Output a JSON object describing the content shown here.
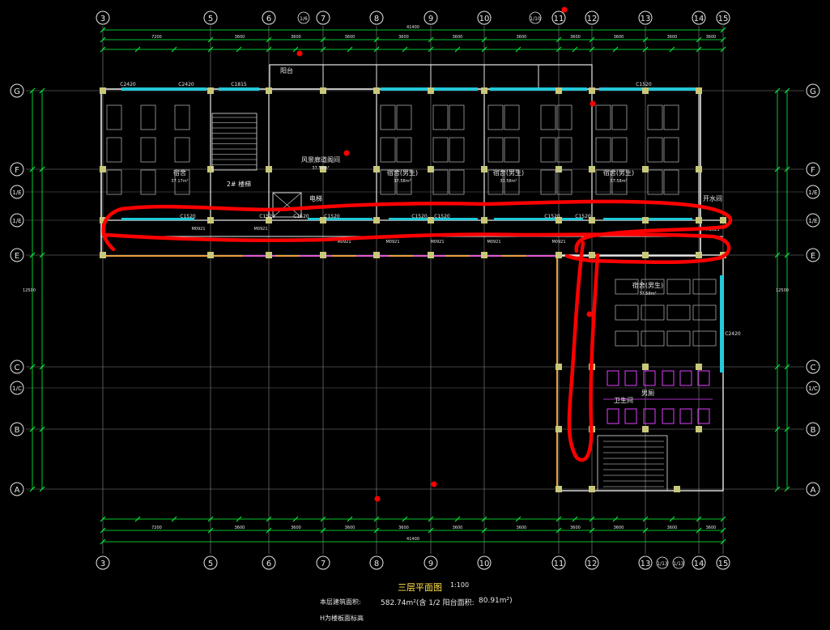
{
  "drawing": {
    "title": "三层平面图",
    "scale": "1:100",
    "area_label": "本层建筑面积:",
    "area_value": "582.74m²(含 1/2 阳台面积:",
    "balcony_area": "80.91m²)",
    "note": "H为楼板面标高"
  },
  "axes": {
    "column_labels": [
      "3",
      "5",
      "6",
      "7",
      "8",
      "9",
      "10",
      "11",
      "12",
      "13",
      "14",
      "15"
    ],
    "row_labels": [
      "G",
      "F",
      "E",
      "C",
      "B",
      "A"
    ],
    "row_half_labels": [
      "1/E",
      "1/E",
      "1/C"
    ]
  },
  "dims": {
    "top_total": "41400",
    "top": [
      "7200",
      "3600",
      "3600",
      "3600",
      "3600",
      "3600",
      "3600",
      "3600",
      "3600",
      "3600",
      "3600"
    ],
    "bottom_total": "41400",
    "bottom": [
      "7200",
      "3600",
      "3600",
      "3600",
      "3600",
      "3600",
      "3600",
      "3600",
      "3600",
      "3600",
      "3600"
    ],
    "left_total": "12500",
    "right_total": "12500"
  },
  "rooms": [
    {
      "key": "dorm1",
      "name": "宿舍",
      "area": "37.17m²"
    },
    {
      "key": "stair1",
      "name": "2# 楼梯"
    },
    {
      "key": "lounge",
      "name": "风景廊道阁间",
      "area": "37.58m²"
    },
    {
      "key": "elev",
      "name": "电梯"
    },
    {
      "key": "dorm2",
      "name": "宿舍(男生)",
      "area": "37.58m²"
    },
    {
      "key": "dorm3",
      "name": "宿舍(男生)",
      "area": "37.58m²"
    },
    {
      "key": "dorm4",
      "name": "宿舍(男生)",
      "area": "37.58m²"
    },
    {
      "key": "water",
      "name": "开水间"
    },
    {
      "key": "dorm5",
      "name": "宿舍(男生)",
      "area": "37.58m²"
    },
    {
      "key": "bath",
      "name": "卫生间"
    },
    {
      "key": "toilet",
      "name": "男厕"
    },
    {
      "key": "balc",
      "name": "阳台"
    }
  ],
  "windows": [
    "C2420",
    "C2420",
    "C1815",
    "C1520",
    "C1520",
    "C1520",
    "C1520",
    "C1520",
    "C1520",
    "C1520",
    "C1520",
    "C1520",
    "C2420"
  ],
  "doors": [
    "M0921",
    "M0921",
    "M0921",
    "M0921",
    "M0921",
    "M0921",
    "M0921",
    "M1021"
  ],
  "colors": {
    "background": "#000000",
    "grid": "#00ff3c",
    "wall": "#e8e8e8",
    "column": "#c8c87a",
    "window": "#23c8d8",
    "text": "#e8e8e8",
    "yellow_text": "#ffe14a",
    "markup": "#ff0000",
    "purple": "#e040ff",
    "orange": "#e8a040"
  }
}
